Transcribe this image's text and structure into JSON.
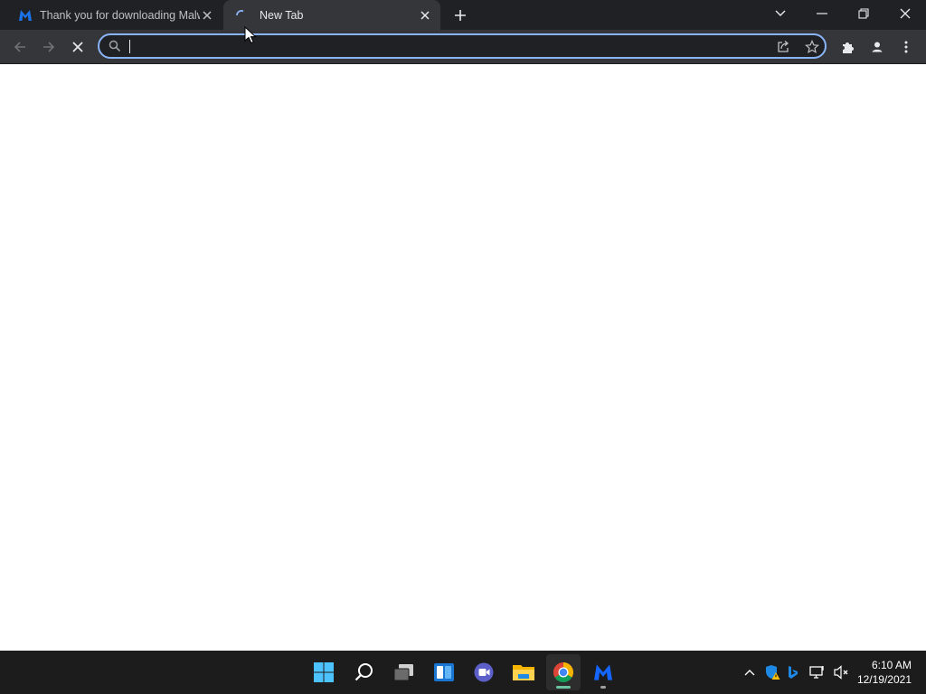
{
  "browser": {
    "tabs": [
      {
        "title": "Thank you for downloading Malw",
        "favicon": "malwarebytes-logo-icon",
        "active": false
      },
      {
        "title": "New Tab",
        "favicon": "loading-spinner-icon",
        "active": true
      }
    ],
    "new_tab_icon": "plus-icon",
    "window_controls": [
      "tab-search-chevron-icon",
      "minimize-icon",
      "restore-icon",
      "close-icon"
    ],
    "toolbar": {
      "back_icon": "back-arrow-icon",
      "forward_icon": "forward-arrow-icon",
      "stop_icon": "stop-x-icon",
      "omnibox": {
        "value": "",
        "placeholder": "",
        "search_icon": "search-icon"
      },
      "share_icon": "share-icon",
      "bookmark_icon": "star-icon",
      "extensions_icon": "puzzle-icon",
      "profile_icon": "profile-icon",
      "menu_icon": "kebab-menu-icon"
    },
    "colors": {
      "tabstrip": "#202124",
      "active_tab": "#35363a",
      "omnibox_focus": "#8ab4f8"
    }
  },
  "taskbar": {
    "apps": [
      {
        "name": "start",
        "icon": "windows-start-icon"
      },
      {
        "name": "search",
        "icon": "search-icon"
      },
      {
        "name": "task-view",
        "icon": "task-view-icon"
      },
      {
        "name": "widgets",
        "icon": "widgets-icon"
      },
      {
        "name": "teams-chat",
        "icon": "chat-icon"
      },
      {
        "name": "file-explorer",
        "icon": "folder-icon"
      },
      {
        "name": "chrome",
        "icon": "chrome-icon",
        "running": true,
        "active": true
      },
      {
        "name": "malwarebytes",
        "icon": "malwarebytes-logo-icon",
        "running": true
      }
    ],
    "tray": [
      "chevron-up-icon",
      "defender-warning-icon",
      "bing-icon",
      "network-icon",
      "volume-muted-icon"
    ],
    "clock": {
      "time": "6:10 AM",
      "date": "12/19/2021"
    }
  }
}
